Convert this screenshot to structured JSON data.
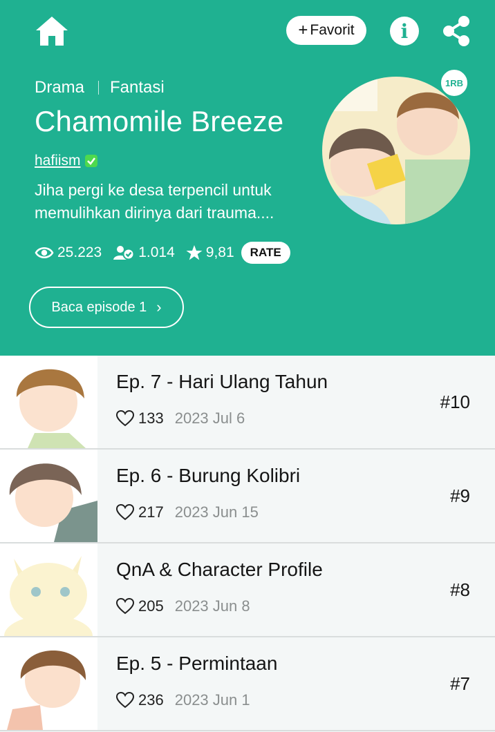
{
  "header": {
    "favorite_label": "Favorit",
    "info_label": "i"
  },
  "series": {
    "genres": [
      "Drama",
      "Fantasi"
    ],
    "title": "Chamomile Breeze",
    "author": "hafiism",
    "description_line1": "Jiha pergi ke desa terpencil untuk",
    "description_line2": "memulihkan dirinya dari trauma....",
    "popularity_badge": "1RB"
  },
  "stats": {
    "views": "25.223",
    "subscribers": "1.014",
    "rating": "9,81",
    "rate_label": "RATE"
  },
  "read_button": {
    "label": "Baca episode 1",
    "chevron": "›"
  },
  "episodes": [
    {
      "title": "Ep. 7 - Hari Ulang Tahun",
      "likes": "133",
      "date": "2023 Jul 6",
      "number": "#10"
    },
    {
      "title": "Ep. 6 - Burung Kolibri",
      "likes": "217",
      "date": "2023 Jun 15",
      "number": "#9"
    },
    {
      "title": "QnA & Character Profile",
      "likes": "205",
      "date": "2023 Jun 8",
      "number": "#8"
    },
    {
      "title": "Ep. 5 - Permintaan",
      "likes": "236",
      "date": "2023 Jun 1",
      "number": "#7"
    }
  ],
  "colors": {
    "brand": "#1fb191",
    "verified": "#4ed94e"
  },
  "icons": {
    "home": "home-icon",
    "share": "share-icon",
    "views": "eye-icon",
    "subscribers": "subscriber-icon",
    "rating": "star-icon",
    "likes": "heart-icon",
    "verified": "verified-check-icon"
  }
}
